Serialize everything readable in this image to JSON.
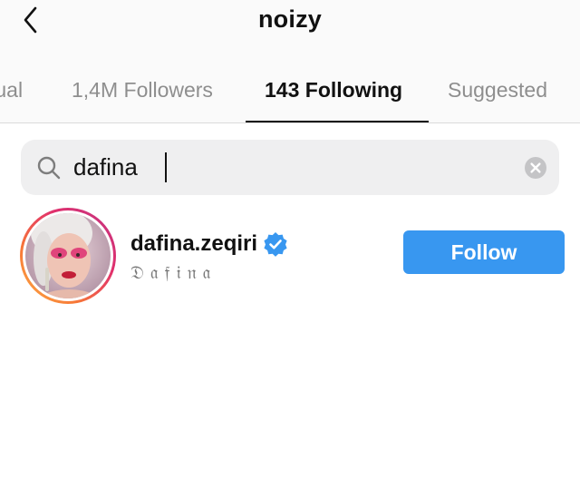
{
  "header": {
    "title": "noizy",
    "back_icon": "chevron-left-icon"
  },
  "tabs": [
    {
      "label": "Mutual",
      "visible_label": "tual",
      "active": false
    },
    {
      "label": "1,4M Followers",
      "active": false
    },
    {
      "label": "143 Following",
      "active": true
    },
    {
      "label": "Suggested",
      "active": false
    }
  ],
  "search": {
    "value": "dafina",
    "icon": "search-icon",
    "clear_icon": "clear-icon"
  },
  "results": [
    {
      "username": "dafina.zeqiri",
      "full_name": "𝔇𝔞𝔣𝔦𝔫𝔞",
      "verified": true,
      "follow_label": "Follow"
    }
  ],
  "colors": {
    "accent": "#3897f0",
    "verified": "#3897f0",
    "muted_text": "#8e8e8e",
    "search_bg": "#efeff0",
    "story_ring": [
      "#c13584",
      "#e1306c",
      "#f77737",
      "#fcaf45"
    ]
  }
}
